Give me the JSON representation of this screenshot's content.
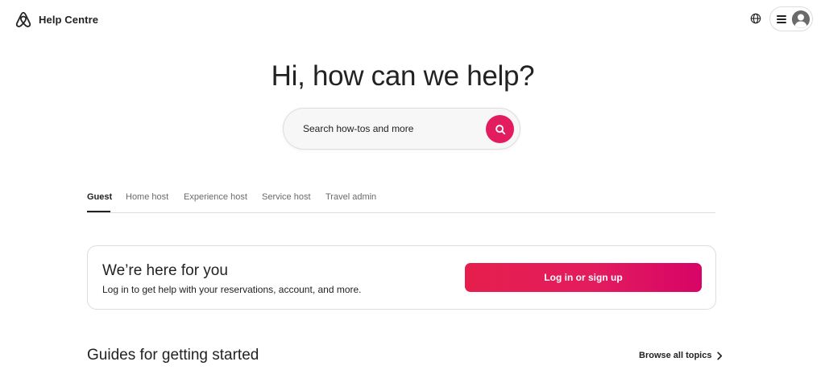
{
  "header": {
    "brand_title": "Help Centre",
    "logo_icon": "airbnb-logo-icon",
    "globe_icon": "globe-icon",
    "menu_icon": "hamburger-menu-icon",
    "avatar_icon": "user-avatar-icon"
  },
  "hero": {
    "title": "Hi, how can we help?"
  },
  "search": {
    "placeholder": "Search how-tos and more",
    "value": "",
    "button_icon": "search-icon"
  },
  "tabs": [
    {
      "label": "Guest",
      "active": true
    },
    {
      "label": "Home host",
      "active": false
    },
    {
      "label": "Experience host",
      "active": false
    },
    {
      "label": "Service host",
      "active": false
    },
    {
      "label": "Travel admin",
      "active": false
    }
  ],
  "login_card": {
    "title": "We’re here for you",
    "subtitle": "Log in to get help with your reservations, account, and more.",
    "button_label": "Log in or sign up"
  },
  "guides": {
    "title": "Guides for getting started",
    "browse_label": "Browse all topics",
    "browse_icon": "chevron-right-icon"
  },
  "colors": {
    "accent": "#e31c5f",
    "text": "#222222",
    "muted": "#6a6a6a",
    "border": "#dddddd"
  }
}
